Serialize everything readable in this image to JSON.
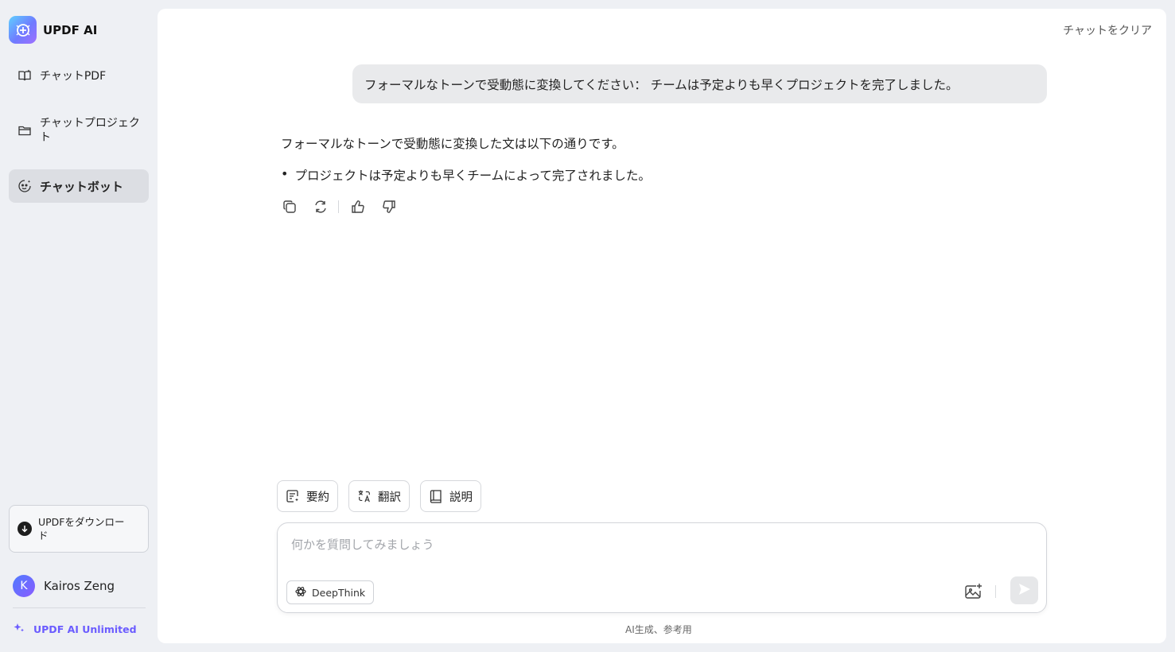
{
  "brand": {
    "title": "UPDF AI",
    "logo_icon": "updf-ai-logo-icon"
  },
  "sidebar": {
    "items": [
      {
        "label": "チャットPDF",
        "icon": "book-open-icon",
        "active": false
      },
      {
        "label": "チャットプロジェクト",
        "icon": "folder-icon",
        "active": false
      },
      {
        "label": "チャットボット",
        "icon": "bot-face-icon",
        "active": true
      }
    ],
    "download_label": "UPDFをダウンロード",
    "user_name": "Kairos Zeng",
    "avatar_initial": "K",
    "unlimited_label": "UPDF AI Unlimited"
  },
  "header": {
    "clear_chat": "チャットをクリア"
  },
  "chat": {
    "user_message": "フォーマルなトーンで受動態に変換してください：  チームは予定よりも早くプロジェクトを完了しました。",
    "response_intro": "フォーマルなトーンで受動態に変換した文は以下の通りです。",
    "response_bullets": [
      "プロジェクトは予定よりも早くチームによって完了されました。"
    ],
    "actions": [
      "copy-icon",
      "regenerate-icon",
      "thumbs-up-icon",
      "thumbs-down-icon"
    ]
  },
  "quick_actions": [
    {
      "label": "要約",
      "icon": "summary-icon"
    },
    {
      "label": "翻訳",
      "icon": "translate-icon"
    },
    {
      "label": "説明",
      "icon": "book-icon"
    }
  ],
  "composer": {
    "placeholder": "何かを質問してみましょう",
    "value": "",
    "deepthink_label": "DeepThink"
  },
  "footer": {
    "disclaimer": "AI生成、参考用"
  },
  "colors": {
    "accent": "#6b5cff",
    "background": "#eef0f4",
    "active_nav": "#dcdee3",
    "user_bubble": "#e9eaec"
  }
}
